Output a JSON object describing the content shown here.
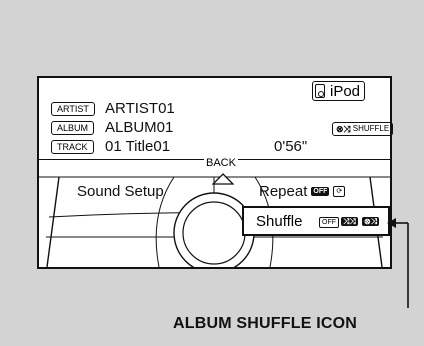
{
  "track_info": {
    "artist_tag": "ARTIST",
    "artist_value": "ARTIST01",
    "album_tag": "ALBUM",
    "album_value": "ALBUM01",
    "track_tag": "TRACK",
    "track_value": "01 Title01",
    "elapsed_time": "0'56\"",
    "source_label": "iPod",
    "shuffle_indicator_label": "SHUFFLE"
  },
  "menu": {
    "back_label": "BACK",
    "items": [
      {
        "label": "Sound Setup"
      },
      {
        "label": "Repeat",
        "options": [
          "OFF",
          "REPEAT"
        ]
      },
      {
        "label": "Shuffle",
        "options": [
          "OFF",
          "SHUFFLE",
          "ALBUM SHUFFLE"
        ]
      }
    ]
  },
  "callout": {
    "label": "ALBUM SHUFFLE ICON"
  }
}
